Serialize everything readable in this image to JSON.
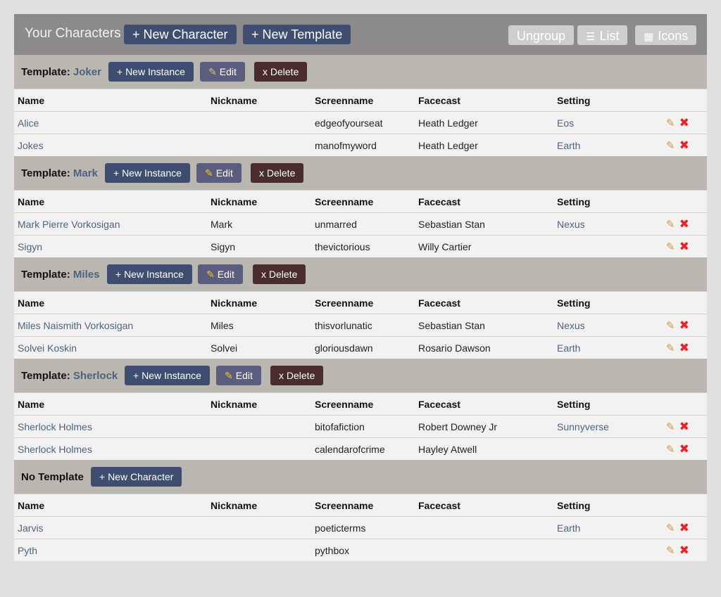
{
  "header": {
    "title": "Your Characters",
    "new_character": "+ New Character",
    "new_template": "+ New Template",
    "ungroup": "Ungroup",
    "list": "List",
    "icons": "Icons"
  },
  "columns": [
    "Name",
    "Nickname",
    "Screenname",
    "Facecast",
    "Setting"
  ],
  "labels": {
    "template_prefix": "Template:",
    "new_instance": "+ New Instance",
    "edit": "Edit",
    "delete": "x Delete",
    "no_template": "No Template",
    "new_character": "+ New Character"
  },
  "icons": {
    "edit": "pencil-icon",
    "delete": "red-x-icon",
    "list": "list-icon",
    "grid": "grid-icon"
  },
  "colors": {
    "navy": "#3f4e70",
    "link": "#4d6380",
    "delete_btn": "#4a2c2c",
    "header_bar": "#8c8a8c",
    "group_bar": "#b9b7b0"
  },
  "groups": [
    {
      "template": "Joker",
      "rows": [
        {
          "name": "Alice",
          "nickname": "",
          "screenname": "edgeofyourseat",
          "facecast": "Heath Ledger",
          "setting": "Eos"
        },
        {
          "name": "Jokes",
          "nickname": "",
          "screenname": "manofmyword",
          "facecast": "Heath Ledger",
          "setting": "Earth"
        }
      ]
    },
    {
      "template": "Mark",
      "rows": [
        {
          "name": "Mark Pierre Vorkosigan",
          "nickname": "Mark",
          "screenname": "unmarred",
          "facecast": "Sebastian Stan",
          "setting": "Nexus"
        },
        {
          "name": "Sigyn",
          "nickname": "Sigyn",
          "screenname": "thevictorious",
          "facecast": "Willy Cartier",
          "setting": ""
        }
      ]
    },
    {
      "template": "Miles",
      "rows": [
        {
          "name": "Miles Naismith Vorkosigan",
          "nickname": "Miles",
          "screenname": "thisvorlunatic",
          "facecast": "Sebastian Stan",
          "setting": "Nexus"
        },
        {
          "name": "Solvei Koskin",
          "nickname": "Solvei",
          "screenname": "gloriousdawn",
          "facecast": "Rosario Dawson",
          "setting": "Earth"
        }
      ]
    },
    {
      "template": "Sherlock",
      "rows": [
        {
          "name": "Sherlock Holmes",
          "nickname": "",
          "screenname": "bitofafiction",
          "facecast": "Robert Downey Jr",
          "setting": "Sunnyverse"
        },
        {
          "name": "Sherlock Holmes",
          "nickname": "",
          "screenname": "calendarofcrime",
          "facecast": "Hayley Atwell",
          "setting": ""
        }
      ]
    }
  ],
  "no_template_rows": [
    {
      "name": "Jarvis",
      "nickname": "",
      "screenname": "poeticterms",
      "facecast": "",
      "setting": "Earth"
    },
    {
      "name": "Pyth",
      "nickname": "",
      "screenname": "pythbox",
      "facecast": "",
      "setting": ""
    }
  ]
}
